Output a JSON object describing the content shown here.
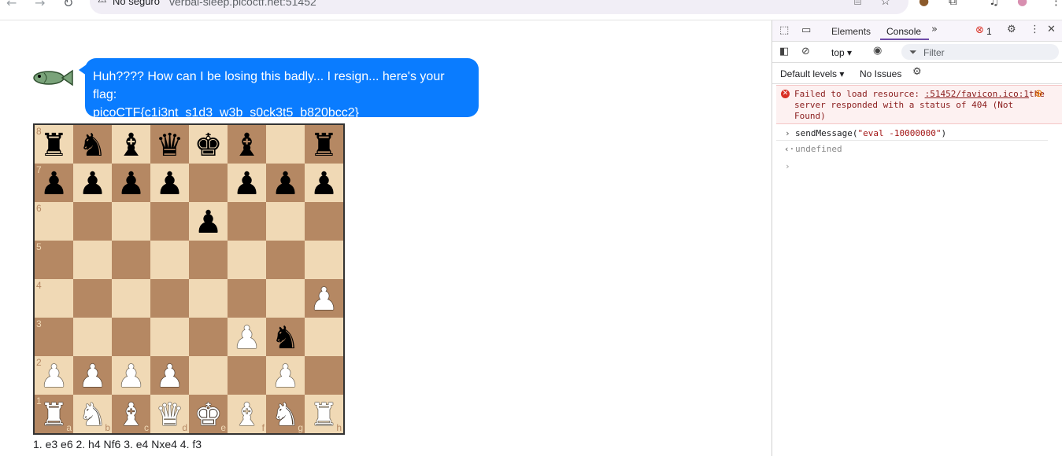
{
  "browser": {
    "security_label": "No seguro",
    "url": "verbal-sleep.picoctf.net:51452"
  },
  "chat": {
    "message_line1": "Huh???? How can I be losing this badly... I resign... here's your flag:",
    "message_line2": "picoCTF{c1i3nt_s1d3_w3b_s0ck3t5_b820bcc2}"
  },
  "board": {
    "ranks": [
      "8",
      "7",
      "6",
      "5",
      "4",
      "3",
      "2",
      "1"
    ],
    "files": [
      "a",
      "b",
      "c",
      "d",
      "e",
      "f",
      "g",
      "h"
    ],
    "position": [
      [
        "bR",
        "bN",
        "bB",
        "bQ",
        "bK",
        "bB",
        "",
        "bR"
      ],
      [
        "bP",
        "bP",
        "bP",
        "bP",
        "",
        "bP",
        "bP",
        "bP"
      ],
      [
        "",
        "",
        "",
        "",
        "bP",
        "",
        "",
        ""
      ],
      [
        "",
        "",
        "",
        "",
        "",
        "",
        "",
        ""
      ],
      [
        "",
        "",
        "",
        "",
        "",
        "",
        "",
        "wP"
      ],
      [
        "",
        "",
        "",
        "",
        "",
        "wP",
        "bN",
        ""
      ],
      [
        "wP",
        "wP",
        "wP",
        "wP",
        "",
        "",
        "wP",
        ""
      ],
      [
        "wR",
        "wN",
        "wB",
        "wQ",
        "wK",
        "wB",
        "wN",
        "wR"
      ]
    ],
    "moves": "1. e3 e6 2. h4 Nf6 3. e4 Nxe4 4. f3"
  },
  "devtools": {
    "tab_elements": "Elements",
    "tab_console": "Console",
    "error_count": "1",
    "context": "top",
    "filter_placeholder": "Filter",
    "levels": "Default levels",
    "issues": "No Issues",
    "error_prefix": "Failed to load resource: ",
    "error_link": ":51452/favicon.ico:1",
    "error_rest": "the server responded with a status of 404 (Not Found)",
    "command_fn": "sendMessage(",
    "command_arg": "\"eval -10000000\"",
    "command_close": ")",
    "result": "undefined"
  }
}
